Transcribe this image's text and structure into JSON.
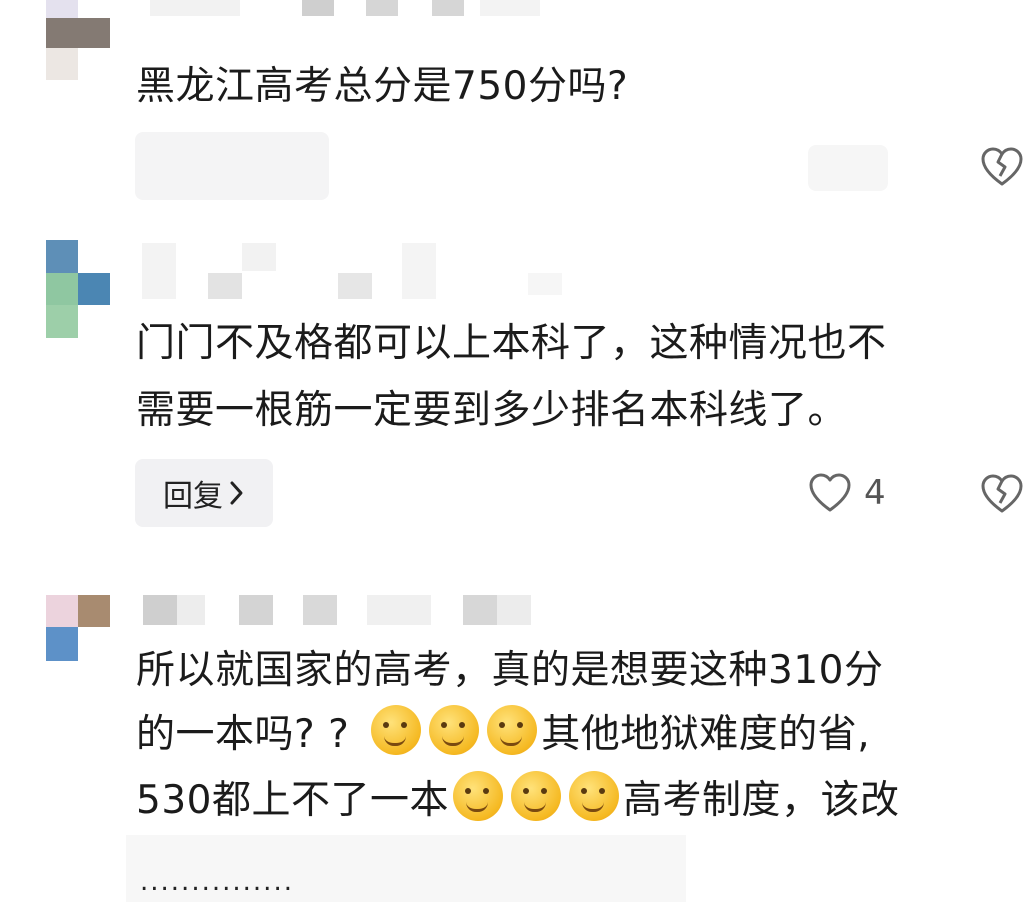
{
  "comments": [
    {
      "text_lines": [
        "黑龙江高考总分是750分吗?"
      ],
      "actions": {
        "reply_label": "",
        "like_count": ""
      }
    },
    {
      "text_lines": [
        "门门不及格都可以上本科了，这种情况也不",
        "需要一根筋一定要到多少排名本科线了。"
      ],
      "actions": {
        "reply_label": "回复",
        "like_count": "4"
      }
    },
    {
      "text_lines": [
        "所以就国家的高考，真的是想要这种310分",
        "的一本吗? ?",
        "其他地狱难度的省,",
        "530都上不了一本",
        "高考制度，该改"
      ],
      "trailing_text": "...............",
      "emoji": [
        "sleepy-emoji",
        "smug-emoji"
      ]
    }
  ],
  "colors": {
    "text": "#1b1b1b",
    "reply_bg": "#f1f1f3",
    "icon": "#666666"
  },
  "icons": [
    "heart-icon",
    "broken-heart-icon",
    "chevron-right-icon"
  ]
}
